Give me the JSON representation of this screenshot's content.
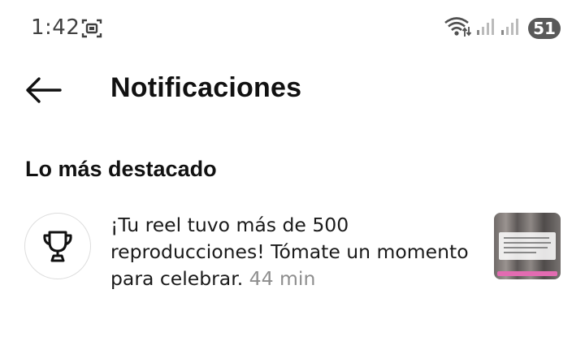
{
  "status_bar": {
    "time": "1:42",
    "battery": "51",
    "icons": [
      "screen-record-icon",
      "wifi-icon",
      "signal-icon",
      "signal-icon"
    ]
  },
  "header": {
    "title": "Notificaciones",
    "back_icon": "arrow-left-icon"
  },
  "section": {
    "heading": "Lo más destacado"
  },
  "notification": {
    "icon": "trophy-icon",
    "message": "¡Tu reel tuvo más de 500 reproducciones! Tómate un momento para celebrar.",
    "time": "44 min",
    "thumbnail": "reel-thumbnail"
  },
  "colors": {
    "text_primary": "#111111",
    "text_secondary": "#8e8e8e",
    "status_gray": "#404040",
    "battery_bg": "#595959",
    "thumb_accent": "#e26bb1"
  }
}
